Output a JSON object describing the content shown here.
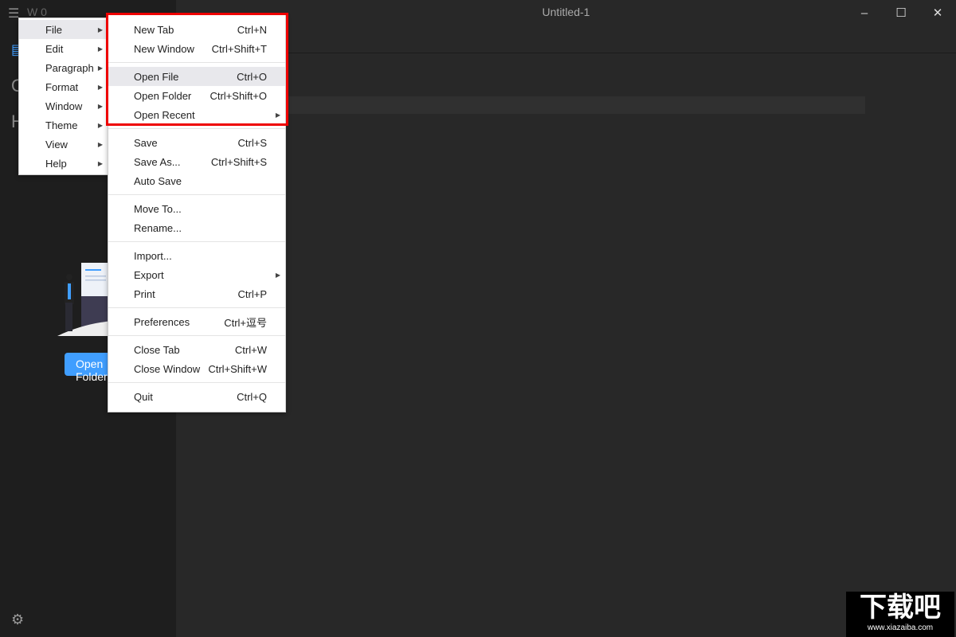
{
  "window": {
    "title": "Untitled-1",
    "minimize": "–",
    "maximize": "☐",
    "close": "✕"
  },
  "sidebar": {
    "word_count": "W 0",
    "open_button": "Open Folder"
  },
  "main_menu": [
    {
      "label": "File",
      "highlighted": true
    },
    {
      "label": "Edit"
    },
    {
      "label": "Paragraph"
    },
    {
      "label": "Format"
    },
    {
      "label": "Window"
    },
    {
      "label": "Theme"
    },
    {
      "label": "View"
    },
    {
      "label": "Help"
    }
  ],
  "file_menu": [
    {
      "label": "New Tab",
      "shortcut": "Ctrl+N"
    },
    {
      "label": "New Window",
      "shortcut": "Ctrl+Shift+T"
    },
    {
      "sep": true
    },
    {
      "label": "Open File",
      "shortcut": "Ctrl+O",
      "highlighted": true
    },
    {
      "label": "Open Folder",
      "shortcut": "Ctrl+Shift+O"
    },
    {
      "label": "Open Recent",
      "submenu": true
    },
    {
      "sep": true
    },
    {
      "label": "Save",
      "shortcut": "Ctrl+S"
    },
    {
      "label": "Save As...",
      "shortcut": "Ctrl+Shift+S"
    },
    {
      "label": "Auto Save"
    },
    {
      "sep": true
    },
    {
      "label": "Move To..."
    },
    {
      "label": "Rename..."
    },
    {
      "sep": true
    },
    {
      "label": "Import..."
    },
    {
      "label": "Export",
      "submenu": true
    },
    {
      "label": "Print",
      "shortcut": "Ctrl+P"
    },
    {
      "sep": true
    },
    {
      "label": "Preferences",
      "shortcut": "Ctrl+逗号"
    },
    {
      "sep": true
    },
    {
      "label": "Close Tab",
      "shortcut": "Ctrl+W"
    },
    {
      "label": "Close Window",
      "shortcut": "Ctrl+Shift+W"
    },
    {
      "sep": true
    },
    {
      "label": "Quit",
      "shortcut": "Ctrl+Q"
    }
  ],
  "watermark": {
    "text": "下载吧",
    "url": "www.xiazaiba.com"
  },
  "colors": {
    "accent": "#409eff",
    "highlight_box": "#e00000"
  }
}
